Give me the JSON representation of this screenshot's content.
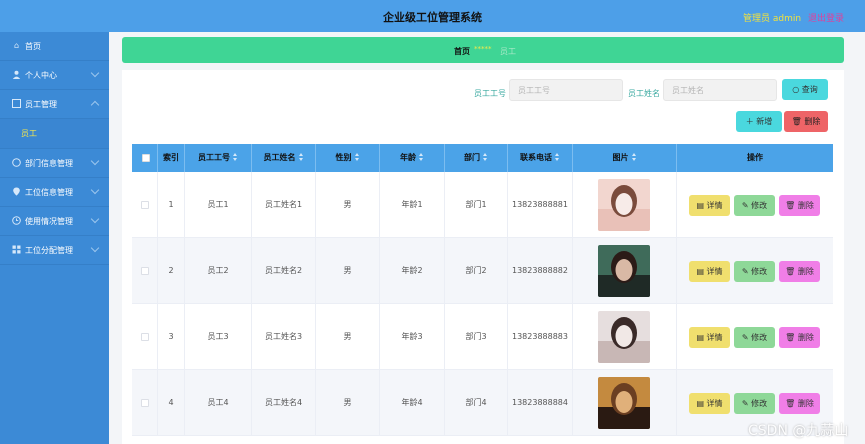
{
  "header": {
    "title": "企业级工位管理系统",
    "user_label": "管理员 admin",
    "logout_label": "退出登录"
  },
  "sidebar": {
    "items": [
      {
        "label": "首页",
        "icon": "home-icon",
        "has_chevron": false
      },
      {
        "label": "个人中心",
        "icon": "person-icon",
        "has_chevron": true
      },
      {
        "label": "员工管理",
        "icon": "list-icon",
        "has_chevron": true,
        "open": true,
        "children": [
          {
            "label": "员工"
          }
        ]
      },
      {
        "label": "部门信息管理",
        "icon": "circle-icon",
        "has_chevron": true
      },
      {
        "label": "工位信息管理",
        "icon": "location-icon",
        "has_chevron": true
      },
      {
        "label": "使用情况管理",
        "icon": "clock-icon",
        "has_chevron": true
      },
      {
        "label": "工位分配管理",
        "icon": "grid-icon",
        "has_chevron": true
      }
    ]
  },
  "breadcrumb": {
    "home": "首页",
    "stars": "*****",
    "current": "员工"
  },
  "search": {
    "field1_label": "员工工号",
    "field1_placeholder": "员工工号",
    "field2_label": "员工姓名",
    "field2_placeholder": "员工姓名",
    "query_label": "查询"
  },
  "actions": {
    "add_label": "新增",
    "delete_label": "删除"
  },
  "table": {
    "columns": [
      "",
      "索引",
      "员工工号",
      "员工姓名",
      "性别",
      "年龄",
      "部门",
      "联系电话",
      "图片",
      "操作"
    ],
    "rows": [
      {
        "index": "1",
        "emp_no": "员工1",
        "name": "员工姓名1",
        "gender": "男",
        "age": "年龄1",
        "dept": "部门1",
        "phone": "13823888881",
        "photo": "employee-photo"
      },
      {
        "index": "2",
        "emp_no": "员工2",
        "name": "员工姓名2",
        "gender": "男",
        "age": "年龄2",
        "dept": "部门2",
        "phone": "13823888882",
        "photo": "employee-photo"
      },
      {
        "index": "3",
        "emp_no": "员工3",
        "name": "员工姓名3",
        "gender": "男",
        "age": "年龄3",
        "dept": "部门3",
        "phone": "13823888883",
        "photo": "employee-photo"
      },
      {
        "index": "4",
        "emp_no": "员工4",
        "name": "员工姓名4",
        "gender": "男",
        "age": "年龄4",
        "dept": "部门4",
        "phone": "13823888884",
        "photo": "employee-photo"
      }
    ],
    "row_actions": {
      "detail": "详情",
      "edit": "修改",
      "delete": "删除"
    }
  },
  "watermark": "CSDN @九蒜山",
  "colors": {
    "topbar": "#4d9fe8",
    "sidebar": "#3c8ad6",
    "breadcrumb": "#3fd595",
    "table_header": "#4ba3e8",
    "accent_cyan": "#4ad8de",
    "danger": "#ee6467",
    "detail": "#f0df6e",
    "edit": "#8ed898",
    "remove": "#f07ee7"
  }
}
